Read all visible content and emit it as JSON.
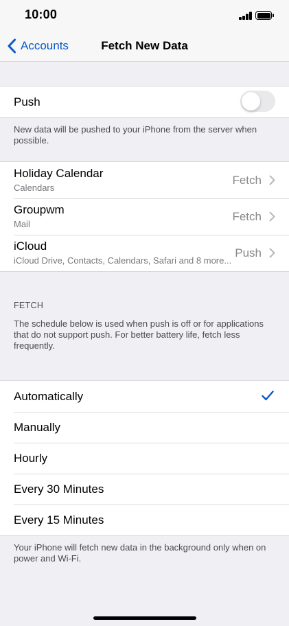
{
  "status": {
    "time": "10:00"
  },
  "nav": {
    "back_label": "Accounts",
    "title": "Fetch New Data"
  },
  "push": {
    "label": "Push",
    "enabled": false,
    "footer": "New data will be pushed to your iPhone from the server when possible."
  },
  "accounts": [
    {
      "title": "Holiday Calendar",
      "subtitle": "Calendars",
      "value": "Fetch"
    },
    {
      "title": "Groupwm",
      "subtitle": "Mail",
      "value": "Fetch"
    },
    {
      "title": "iCloud",
      "subtitle": "iCloud Drive, Contacts, Calendars, Safari and 8 more...",
      "value": "Push"
    }
  ],
  "fetch": {
    "header": "FETCH",
    "description": "The schedule below is used when push is off or for applications that do not support push. For better battery life, fetch less frequently.",
    "options": [
      {
        "label": "Automatically",
        "selected": true
      },
      {
        "label": "Manually",
        "selected": false
      },
      {
        "label": "Hourly",
        "selected": false
      },
      {
        "label": "Every 30 Minutes",
        "selected": false
      },
      {
        "label": "Every 15 Minutes",
        "selected": false
      }
    ],
    "footer": "Your iPhone will fetch new data in the background only when on power and Wi-Fi."
  },
  "colors": {
    "accent": "#0a58c7",
    "background": "#efeff4",
    "toggle_off": "#e9e9eb"
  }
}
